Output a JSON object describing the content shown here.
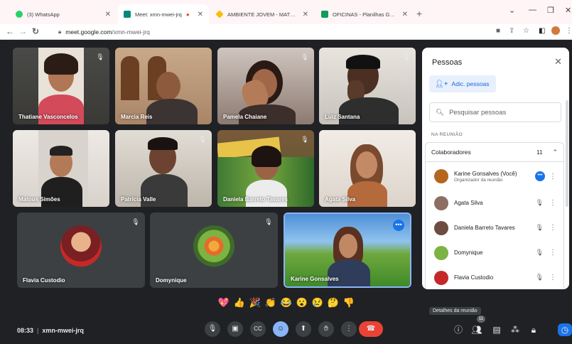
{
  "browser": {
    "tabs": [
      {
        "label": "(3) WhatsApp",
        "active": false,
        "color": "#25d366"
      },
      {
        "label": "Meet: xmn-mwei-jrq",
        "active": true,
        "color": "#00897b"
      },
      {
        "label": "AMBIENTE JOVEM - MATERIAL",
        "active": false,
        "color": "#fbbc04"
      },
      {
        "label": "OFICINAS - Planilhas Google",
        "active": false,
        "color": "#0f9d58"
      }
    ],
    "url_domain": "meet.google.com",
    "url_path": "/xmn-mwei-jrq"
  },
  "tiles": [
    {
      "name": "Thatiane Vasconcelos",
      "muted": true
    },
    {
      "name": "Marcia Reis",
      "muted": false
    },
    {
      "name": "Pamela Chaiane",
      "muted": true
    },
    {
      "name": "Luiz Santana",
      "muted": true
    },
    {
      "name": "Matous Simões",
      "muted": false
    },
    {
      "name": "Patricia Valle",
      "muted": true
    },
    {
      "name": "Daniela Barreto Tavares",
      "muted": true
    },
    {
      "name": "Agata Silva",
      "muted": true
    },
    {
      "name": "Flavia Custodio",
      "muted": true
    },
    {
      "name": "Domynique",
      "muted": true
    },
    {
      "name": "Karine Gonsalves",
      "muted": false
    }
  ],
  "reactions": [
    "💖",
    "👍",
    "🎉",
    "👏",
    "😂",
    "😮",
    "😢",
    "🤔",
    "👎"
  ],
  "bottom": {
    "time": "08:33",
    "meeting_code": "xmn-mwei-jrq",
    "tooltip": "Detalhes da reunião",
    "people_count": "11"
  },
  "panel": {
    "title": "Pessoas",
    "add_people": "Adic. pessoas",
    "search_placeholder": "Pesquisar pessoas",
    "section": "NA REUNIÃO",
    "group_label": "Colaboradores",
    "group_count": "11",
    "participants": [
      {
        "name": "Karine Gonsalves (Você)",
        "role": "Organizador da reunião",
        "color": "#b5651d"
      },
      {
        "name": "Agata Silva",
        "role": "",
        "color": "#8d6e63"
      },
      {
        "name": "Daniela Barreto Tavares",
        "role": "",
        "color": "#6d4c41"
      },
      {
        "name": "Domynique",
        "role": "",
        "color": "#7cb342"
      },
      {
        "name": "Flavia Custodio",
        "role": "",
        "color": "#c62828"
      }
    ]
  }
}
